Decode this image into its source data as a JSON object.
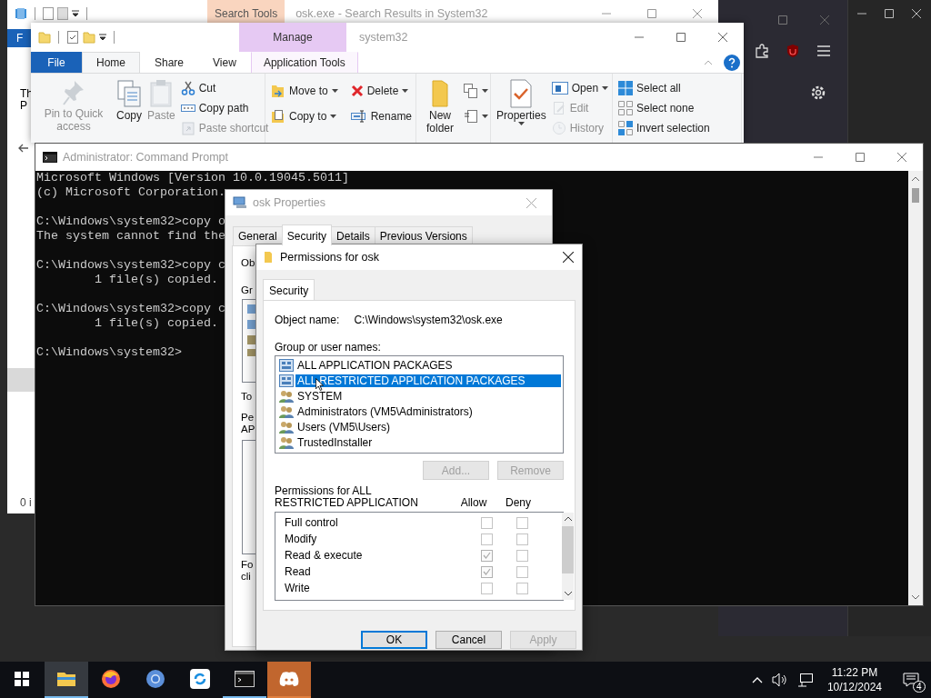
{
  "back_explorer": {
    "context_tab": "Search Tools",
    "title": "osk.exe - Search Results in System32",
    "file_tab": "F",
    "nav_fragments": [
      "Th",
      "P"
    ],
    "status_fragment": "0 i"
  },
  "explorer": {
    "context_group": "Manage",
    "title": "system32",
    "tabs": [
      {
        "label": "File",
        "kind": "file",
        "selected": false
      },
      {
        "label": "Home",
        "kind": "tab",
        "selected": true
      },
      {
        "label": "Share",
        "kind": "tab",
        "selected": false
      },
      {
        "label": "View",
        "kind": "tab",
        "selected": false
      },
      {
        "label": "Application Tools",
        "kind": "context",
        "selected": false
      }
    ],
    "ribbon": [
      {
        "large": [
          {
            "label": "Pin to Quick access",
            "disabled": true,
            "dropdown": false
          },
          {
            "label": "Copy",
            "disabled": false,
            "dropdown": false
          },
          {
            "label": "Paste",
            "disabled": true,
            "dropdown": false
          }
        ],
        "small": [
          {
            "label": "Cut",
            "disabled": false,
            "dropdown": false
          },
          {
            "label": "Copy path",
            "disabled": false,
            "dropdown": false
          },
          {
            "label": "Paste shortcut",
            "disabled": true,
            "dropdown": false
          }
        ]
      },
      {
        "small": [
          {
            "label": "Move to",
            "disabled": false,
            "dropdown": true
          },
          {
            "label": "Copy to",
            "disabled": false,
            "dropdown": true
          },
          {
            "label": "Delete",
            "disabled": false,
            "dropdown": true
          },
          {
            "label": "Rename",
            "disabled": false,
            "dropdown": false
          }
        ]
      },
      {
        "large": [
          {
            "label": "New folder",
            "disabled": false,
            "dropdown": false
          }
        ],
        "small": [
          {
            "disabled": false,
            "dropdown": true
          },
          {
            "disabled": false,
            "dropdown": true
          }
        ]
      },
      {
        "large": [
          {
            "label": "Properties",
            "disabled": false,
            "dropdown": true
          }
        ],
        "small": [
          {
            "label": "Open",
            "disabled": false,
            "dropdown": true
          },
          {
            "label": "Edit",
            "disabled": true,
            "dropdown": false
          },
          {
            "label": "History",
            "disabled": true,
            "dropdown": false
          }
        ]
      },
      {
        "small": [
          {
            "label": "Select all",
            "disabled": false,
            "dropdown": false
          },
          {
            "label": "Select none",
            "disabled": false,
            "dropdown": false
          },
          {
            "label": "Invert selection",
            "disabled": false,
            "dropdown": false
          }
        ]
      }
    ]
  },
  "cmd": {
    "title": "Administrator: Command Prompt",
    "blocks": [
      [
        "Microsoft Windows [Version 10.0.19045.5011]",
        "(c) Microsoft Corporation."
      ],
      [
        "C:\\Windows\\system32>copy o",
        "The system cannot find the"
      ],
      [
        "C:\\Windows\\system32>copy c",
        "        1 file(s) copied."
      ],
      [
        "C:\\Windows\\system32>copy c",
        "        1 file(s) copied."
      ],
      [
        "C:\\Windows\\system32>"
      ]
    ]
  },
  "properties": {
    "title": "osk Properties",
    "tabs": [
      {
        "label": "General",
        "selected": false
      },
      {
        "label": "Security",
        "selected": true
      },
      {
        "label": "Details",
        "selected": false
      },
      {
        "label": "Previous Versions",
        "selected": false
      }
    ],
    "object_fragment": "Ob",
    "group_fragment": "Gr",
    "change_fragment": "To",
    "permissions_fragment": [
      "Pe",
      "AP"
    ],
    "special_fragment": [
      "Fo",
      "cli"
    ]
  },
  "permissions": {
    "title": "Permissions for osk",
    "tabs": [
      {
        "label": "Security",
        "selected": true
      }
    ],
    "object_label": "Object name:",
    "object_value": "C:\\Windows\\system32\\osk.exe",
    "group_label": "Group or user names:",
    "groups": [
      {
        "name": "ALL APPLICATION PACKAGES",
        "kind": "package",
        "selected": false
      },
      {
        "name": "ALL RESTRICTED APPLICATION PACKAGES",
        "kind": "package",
        "selected": true
      },
      {
        "name": "SYSTEM",
        "kind": "group",
        "selected": false
      },
      {
        "name": "Administrators (VM5\\Administrators)",
        "kind": "group",
        "selected": false
      },
      {
        "name": "Users (VM5\\Users)",
        "kind": "group",
        "selected": false
      },
      {
        "name": "TrustedInstaller",
        "kind": "group",
        "selected": false
      }
    ],
    "add_button": {
      "label": "Add...",
      "disabled": true
    },
    "remove_button": {
      "label": "Remove",
      "disabled": true
    },
    "permissions_label": "Permissions for ALL RESTRICTED APPLICATION",
    "allow_header": "Allow",
    "deny_header": "Deny",
    "rows": [
      {
        "name": "Full control",
        "allow": false,
        "deny": false
      },
      {
        "name": "Modify",
        "allow": false,
        "deny": false
      },
      {
        "name": "Read & execute",
        "allow": true,
        "deny": false
      },
      {
        "name": "Read",
        "allow": true,
        "deny": false
      },
      {
        "name": "Write",
        "allow": false,
        "deny": false
      }
    ],
    "buttons": [
      {
        "label": "OK",
        "kind": "default",
        "disabled": false
      },
      {
        "label": "Cancel",
        "kind": "normal",
        "disabled": false
      },
      {
        "label": "Apply",
        "kind": "normal",
        "disabled": true
      }
    ]
  },
  "taskbar": {
    "apps": [
      {
        "selected": true,
        "running": true,
        "flashing": false
      },
      {
        "selected": false,
        "running": false,
        "flashing": false
      },
      {
        "selected": false,
        "running": false,
        "flashing": false
      },
      {
        "selected": false,
        "running": false,
        "flashing": false
      },
      {
        "selected": false,
        "running": true,
        "flashing": false
      },
      {
        "selected": false,
        "running": false,
        "flashing": true
      }
    ],
    "time": "11:22 PM",
    "date": "10/12/2024",
    "notifications": "4"
  }
}
